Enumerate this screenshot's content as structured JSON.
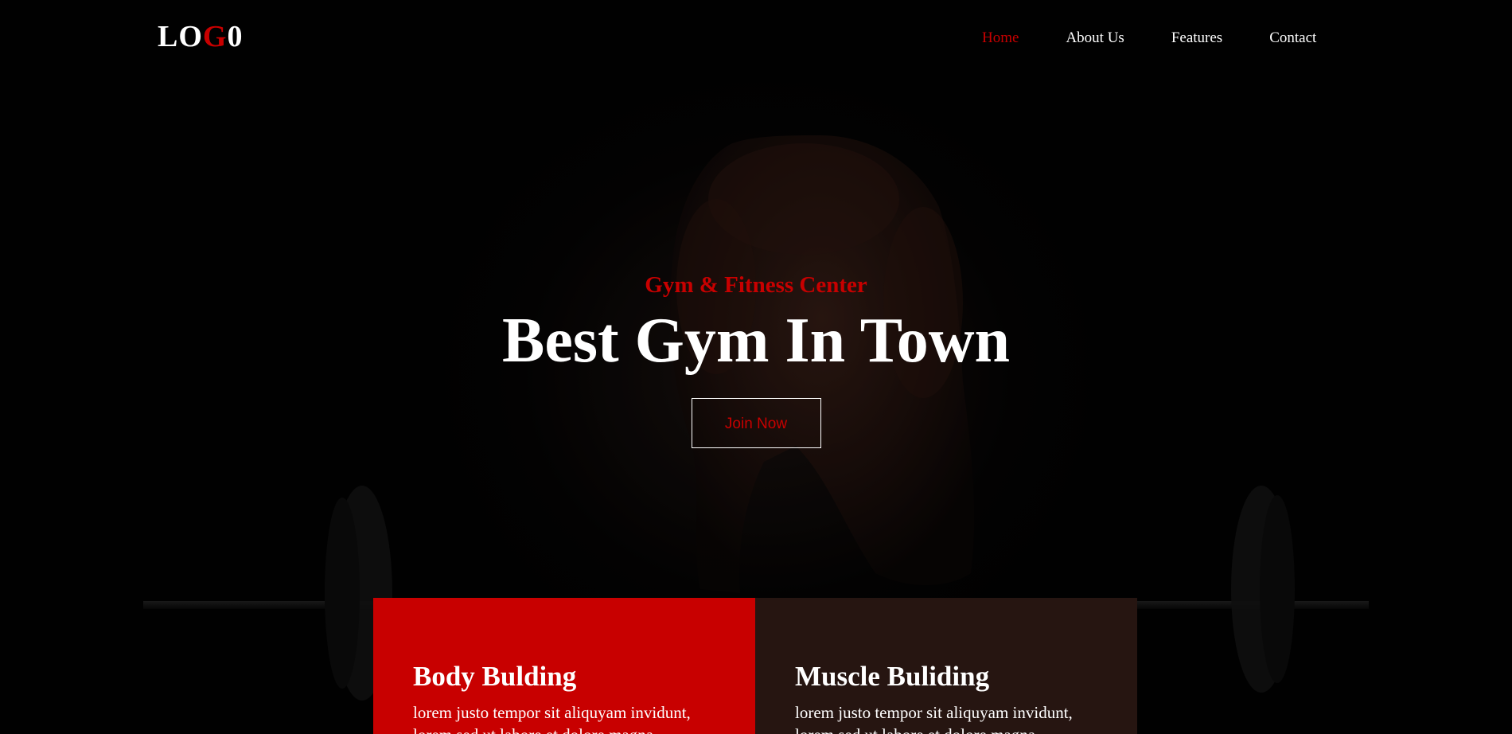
{
  "logo": {
    "part1": "LO",
    "part2": "G",
    "part3": "0"
  },
  "nav": {
    "items": [
      {
        "label": "Home",
        "active": true
      },
      {
        "label": "About Us",
        "active": false
      },
      {
        "label": "Features",
        "active": false
      },
      {
        "label": "Contact",
        "active": false
      }
    ]
  },
  "hero": {
    "subtitle": "Gym & Fitness Center",
    "title": "Best Gym In Town",
    "cta_label": "Join Now"
  },
  "cards": [
    {
      "title": "Body Bulding",
      "text": "lorem justo tempor sit aliquyam invidunt, lorem sed ut labore et dolore magna aliquyam erat"
    },
    {
      "title": "Muscle Buliding",
      "text": "lorem justo tempor sit aliquyam invidunt, lorem sed ut labore et dolore magna aliquyam erat"
    }
  ],
  "colors": {
    "accent": "#c80000",
    "card_dark": "#261511",
    "background": "#000000"
  }
}
